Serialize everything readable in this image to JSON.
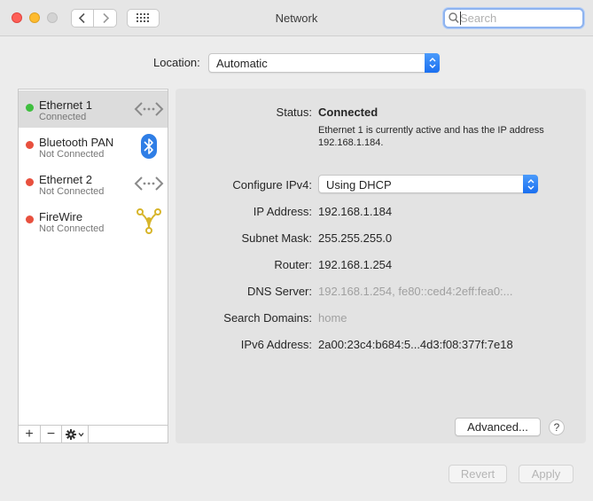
{
  "window": {
    "title": "Network"
  },
  "search": {
    "placeholder": "Search",
    "value": ""
  },
  "location": {
    "label": "Location:",
    "value": "Automatic"
  },
  "services": [
    {
      "name": "Ethernet 1",
      "status": "Connected",
      "status_color": "#3fbf3f",
      "icon": "ethernet-icon",
      "selected": true
    },
    {
      "name": "Bluetooth PAN",
      "status": "Not Connected",
      "status_color": "#e8503e",
      "icon": "bluetooth-icon",
      "selected": false
    },
    {
      "name": "Ethernet 2",
      "status": "Not Connected",
      "status_color": "#e8503e",
      "icon": "ethernet-icon",
      "selected": false
    },
    {
      "name": "FireWire",
      "status": "Not Connected",
      "status_color": "#e8503e",
      "icon": "firewire-icon",
      "selected": false
    }
  ],
  "sidebar_controls": {
    "add": "+",
    "remove": "−",
    "action": "gear-icon"
  },
  "details": {
    "status_label": "Status:",
    "status_value": "Connected",
    "status_desc": "Ethernet 1 is currently active and has the IP address 192.168.1.184.",
    "configure_label": "Configure IPv4:",
    "configure_value": "Using DHCP",
    "ip_label": "IP Address:",
    "ip_value": "192.168.1.184",
    "subnet_label": "Subnet Mask:",
    "subnet_value": "255.255.255.0",
    "router_label": "Router:",
    "router_value": "192.168.1.254",
    "dns_label": "DNS Server:",
    "dns_value": "192.168.1.254, fe80::ced4:2eff:fea0:...",
    "domains_label": "Search Domains:",
    "domains_value": "home",
    "ipv6_label": "IPv6 Address:",
    "ipv6_value": "2a00:23c4:b684:5...4d3:f08:377f:7e18"
  },
  "buttons": {
    "advanced": "Advanced...",
    "help": "?",
    "revert": "Revert",
    "apply": "Apply"
  }
}
